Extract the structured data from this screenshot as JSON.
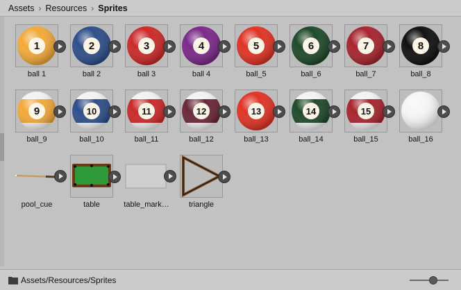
{
  "breadcrumb": [
    "Assets",
    "Resources",
    "Sprites"
  ],
  "footer": {
    "path": "Assets/Resources/Sprites"
  },
  "assets": [
    {
      "label": "ball 1",
      "kind": "ball",
      "number": "1",
      "color": "#f2a93b",
      "stripe": false
    },
    {
      "label": "ball 2",
      "kind": "ball",
      "number": "2",
      "color": "#2f4f8a",
      "stripe": false
    },
    {
      "label": "ball 3",
      "kind": "ball",
      "number": "3",
      "color": "#cc2a2a",
      "stripe": false
    },
    {
      "label": "ball 4",
      "kind": "ball",
      "number": "4",
      "color": "#7b2a8a",
      "stripe": false
    },
    {
      "label": "ball_5",
      "kind": "ball",
      "number": "5",
      "color": "#e03426",
      "stripe": false
    },
    {
      "label": "ball_6",
      "kind": "ball",
      "number": "6",
      "color": "#1f4a2a",
      "stripe": false
    },
    {
      "label": "ball_7",
      "kind": "ball",
      "number": "7",
      "color": "#a8252f",
      "stripe": false
    },
    {
      "label": "ball_8",
      "kind": "ball",
      "number": "8",
      "color": "#111111",
      "stripe": false
    },
    {
      "label": "ball_9",
      "kind": "ball",
      "number": "9",
      "color": "#f2a93b",
      "stripe": true
    },
    {
      "label": "ball_10",
      "kind": "ball",
      "number": "10",
      "color": "#2f4f8a",
      "stripe": true
    },
    {
      "label": "ball_11",
      "kind": "ball",
      "number": "11",
      "color": "#cc2a2a",
      "stripe": true
    },
    {
      "label": "ball_12",
      "kind": "ball",
      "number": "12",
      "color": "#6a2838",
      "stripe": true
    },
    {
      "label": "ball_13",
      "kind": "ball",
      "number": "13",
      "color": "#e03426",
      "stripe": false
    },
    {
      "label": "ball_14",
      "kind": "ball",
      "number": "14",
      "color": "#1f4a2a",
      "stripe": true
    },
    {
      "label": "ball_15",
      "kind": "ball",
      "number": "15",
      "color": "#a8252f",
      "stripe": true
    },
    {
      "label": "ball_16",
      "kind": "cue-ball",
      "number": "",
      "color": "#f5f5f5",
      "stripe": false
    },
    {
      "label": "pool_cue",
      "kind": "cue"
    },
    {
      "label": "table",
      "kind": "table"
    },
    {
      "label": "table_mark…",
      "kind": "marker"
    },
    {
      "label": "triangle",
      "kind": "triangle"
    }
  ]
}
